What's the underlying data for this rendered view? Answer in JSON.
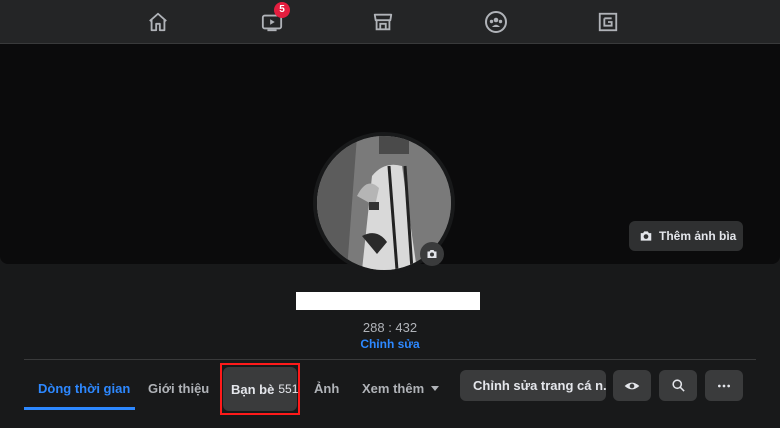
{
  "nav": {
    "video_badge": "5"
  },
  "cover": {
    "add_cover_label": "Thêm ảnh bìa"
  },
  "profile": {
    "count_text": "288 : 432",
    "edit_label": "Chỉnh sửa"
  },
  "tabs": {
    "timeline": "Dòng thời gian",
    "about": "Giới thiệu",
    "friends": "Bạn bè",
    "friends_count": "551",
    "photos": "Ảnh",
    "more": "Xem thêm"
  },
  "actions": {
    "edit_profile_label": "Chỉnh sửa trang cá n..."
  },
  "colors": {
    "accent": "#2d88ff",
    "badge": "#e41e3f",
    "highlight": "#ff1a1a"
  }
}
